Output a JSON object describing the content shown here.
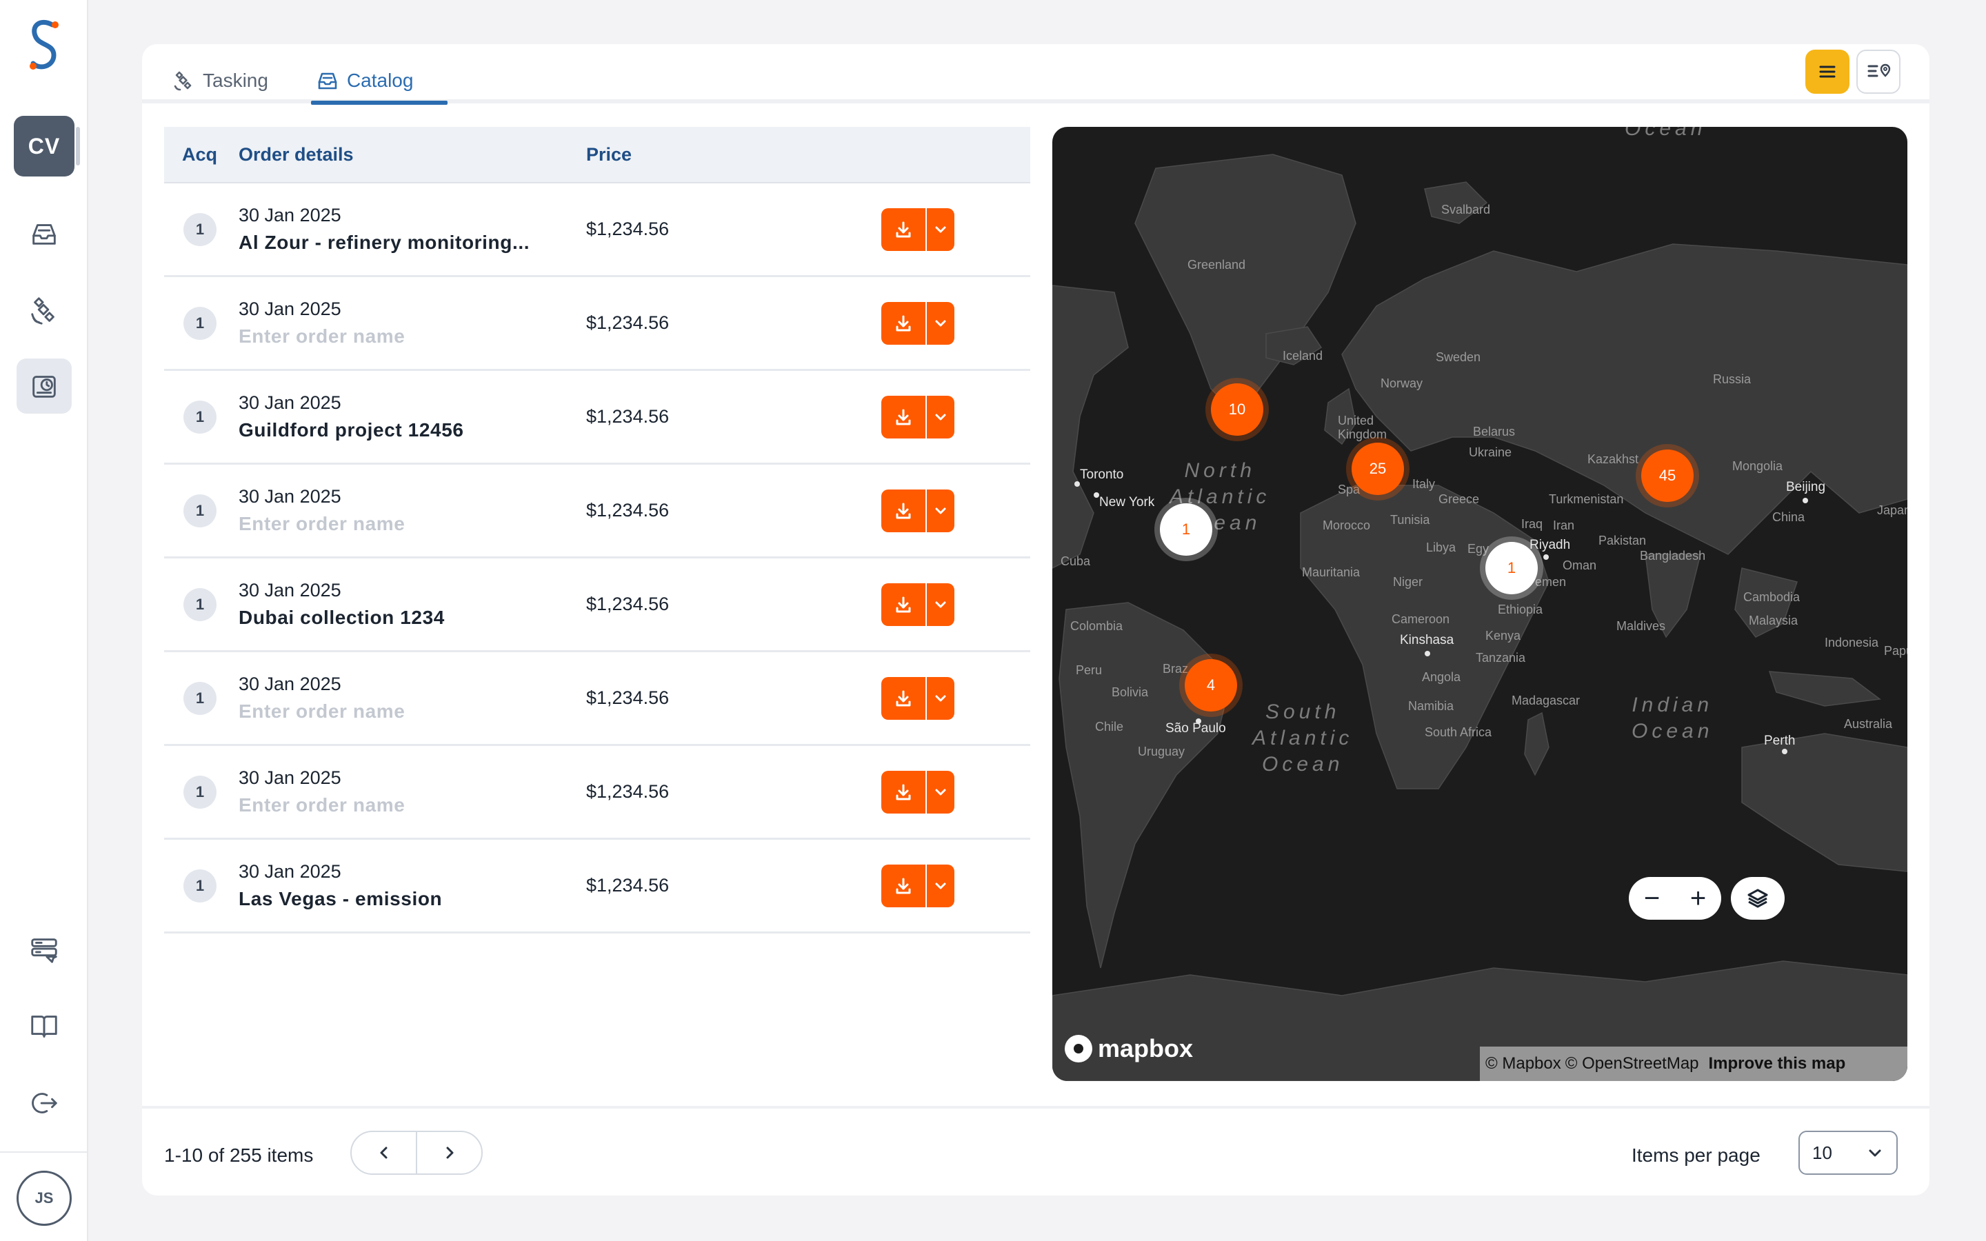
{
  "sidebar": {
    "workspace_initials": "CV",
    "nav_icons": [
      "inbox-icon",
      "satellite-icon",
      "history-icon"
    ],
    "bottom_icons": [
      "server-settings-icon",
      "book-icon",
      "logout-icon"
    ],
    "user_initials": "JS"
  },
  "tabs": [
    {
      "label": "Tasking",
      "icon": "satellite-icon",
      "active": false
    },
    {
      "label": "Catalog",
      "icon": "inbox-icon",
      "active": true
    }
  ],
  "view_toggle": {
    "active": "list",
    "options": [
      "list-icon",
      "map-list-icon"
    ]
  },
  "table": {
    "headers": {
      "acq": "Acq",
      "details": "Order details",
      "price": "Price"
    },
    "rows": [
      {
        "acq": "1",
        "date": "30 Jan 2025",
        "name": "Al Zour - refinery monitoring...",
        "placeholder": false,
        "price": "$1,234.56"
      },
      {
        "acq": "1",
        "date": "30 Jan 2025",
        "name": "Enter order name",
        "placeholder": true,
        "price": "$1,234.56"
      },
      {
        "acq": "1",
        "date": "30 Jan 2025",
        "name": "Guildford project 12456",
        "placeholder": false,
        "price": "$1,234.56"
      },
      {
        "acq": "1",
        "date": "30 Jan 2025",
        "name": "Enter order name",
        "placeholder": true,
        "price": "$1,234.56"
      },
      {
        "acq": "1",
        "date": "30 Jan 2025",
        "name": "Dubai collection 1234",
        "placeholder": false,
        "price": "$1,234.56"
      },
      {
        "acq": "1",
        "date": "30 Jan 2025",
        "name": "Enter order name",
        "placeholder": true,
        "price": "$1,234.56"
      },
      {
        "acq": "1",
        "date": "30 Jan 2025",
        "name": "Enter order name",
        "placeholder": true,
        "price": "$1,234.56"
      },
      {
        "acq": "1",
        "date": "30 Jan 2025",
        "name": "Las Vegas - emission",
        "placeholder": false,
        "price": "$1,234.56"
      }
    ]
  },
  "map": {
    "clusters": [
      {
        "count": "10",
        "style": "orange"
      },
      {
        "count": "25",
        "style": "orange"
      },
      {
        "count": "45",
        "style": "orange"
      },
      {
        "count": "1",
        "style": "white"
      },
      {
        "count": "1",
        "style": "white"
      },
      {
        "count": "4",
        "style": "orange"
      }
    ],
    "labels": {
      "svalbard": "Svalbard",
      "greenland": "Greenland",
      "iceland": "Iceland",
      "sweden": "Sweden",
      "norway": "Norway",
      "russia": "Russia",
      "uk": "United Kingdom",
      "belarus": "Belarus",
      "ukraine": "Ukraine",
      "kazakhstan": "Kazakhst",
      "mongolia": "Mongolia",
      "beijing": "Beijing",
      "toronto": "Toronto",
      "newyork": "New York",
      "italy": "Italy",
      "spain": "Spa",
      "greece": "Greece",
      "turkmenistan": "Turkmenistan",
      "china": "China",
      "japan": "Japan",
      "morocco": "Morocco",
      "tunisia": "Tunisia",
      "iraq": "Iraq",
      "iran": "Iran",
      "libya": "Libya",
      "egypt": "Egy",
      "riyadh": "Riyadh",
      "pakistan": "Pakistan",
      "bangladesh": "Bangladesh",
      "cuba": "Cuba",
      "mauritania": "Mauritania",
      "niger": "Niger",
      "yemen": "emen",
      "oman": "Oman",
      "ethiopia": "Ethiopia",
      "cambodia": "Cambodia",
      "colombia": "Colombia",
      "cameroon": "Cameroon",
      "maldives": "Maldives",
      "malaysia": "Malaysia",
      "kinshasa": "Kinshasa",
      "kenya": "Kenya",
      "indonesia": "Indonesia",
      "peru": "Peru",
      "brazil": "Braz",
      "tanzania": "Tanzania",
      "bolivia": "Bolivia",
      "angola": "Angola",
      "papua": "Pap­u",
      "madagascar": "Madagascar",
      "namibia": "Namibia",
      "chile": "Chile",
      "saopaulo": "São Paulo",
      "southafrica": "South Africa",
      "australia": "Australia",
      "uruguay": "Uruguay",
      "perth": "Perth"
    },
    "oceans": {
      "north_atlantic": "North\nAtlantic\nOcean",
      "south_atlantic": "South\nAtlantic\nOcean",
      "indian": "Indian\nOcean",
      "arctic": "Ocean"
    },
    "zoom_out": "−",
    "zoom_in": "+",
    "brand": "mapbox",
    "attribution": {
      "mapbox": "© Mapbox",
      "osm": "© OpenStreetMap",
      "improve": "Improve this map"
    }
  },
  "footer": {
    "range": "1-10 of 255 items",
    "items_per_page_label": "Items per page",
    "items_per_page_value": "10"
  },
  "colors": {
    "accent": "#ff5a00",
    "primary": "#2b6cb0",
    "toggle_active": "#f6b618"
  }
}
